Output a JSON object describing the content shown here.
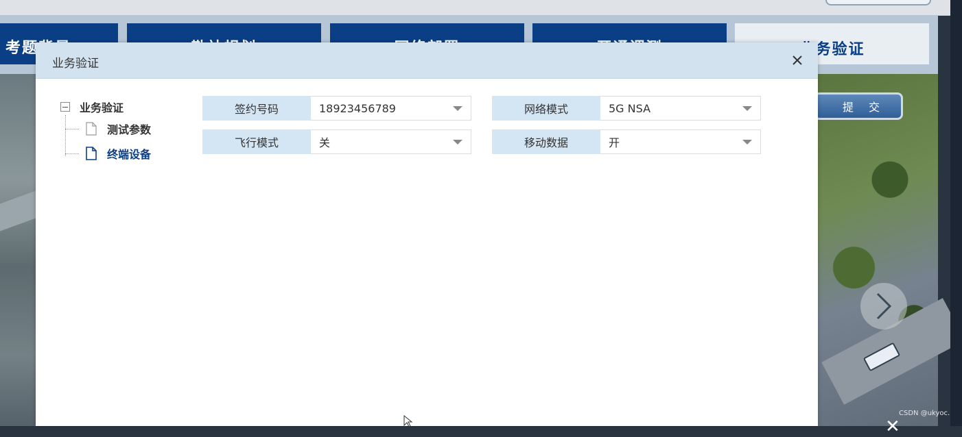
{
  "background": {
    "tabs": [
      {
        "label": "考题背景",
        "active": false
      },
      {
        "label": "勘站规划",
        "active": false
      },
      {
        "label": "网络部署",
        "active": false
      },
      {
        "label": "开通调测",
        "active": false
      },
      {
        "label": "业务验证",
        "active": true
      }
    ],
    "submit_label": "提交",
    "watermark": "CSDN @ukyoc."
  },
  "dialog": {
    "title": "业务验证",
    "tree": {
      "root": "业务验证",
      "children": [
        {
          "label": "测试参数",
          "selected": false
        },
        {
          "label": "终端设备",
          "selected": true
        }
      ]
    },
    "form": {
      "rows": [
        [
          {
            "label": "签约号码",
            "value": "18923456789"
          },
          {
            "label": "网络模式",
            "value": "5G NSA"
          }
        ],
        [
          {
            "label": "飞行模式",
            "value": "关"
          },
          {
            "label": "移动数据",
            "value": "开"
          }
        ]
      ]
    }
  },
  "colors": {
    "tab_blue": "#0a3f86",
    "header_bg": "#d2e2ee",
    "field_label_bg": "#d4e5f4",
    "selected_text": "#0a3f86"
  }
}
